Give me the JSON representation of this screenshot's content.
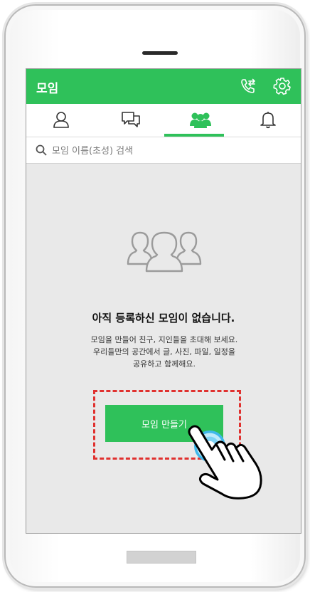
{
  "app": {
    "title": "모임"
  },
  "tabs": [
    {
      "name": "friends",
      "icon": "person-icon",
      "active": false
    },
    {
      "name": "chats",
      "icon": "chat-bubbles-icon",
      "active": false
    },
    {
      "name": "groups",
      "icon": "group-icon",
      "active": true
    },
    {
      "name": "notifications",
      "icon": "bell-icon",
      "active": false
    }
  ],
  "search": {
    "placeholder": "모임 이름(초성) 검색"
  },
  "empty": {
    "title": "아직 등록하신 모임이 없습니다.",
    "desc_line1": "모임을 만들어 친구, 지인들을 초대해 보세요.",
    "desc_line2": "우리들만의 공간에서 글, 사진, 파일, 일정을",
    "desc_line3": "공유하고 함께해요."
  },
  "create_button": {
    "label": "모임 만들기"
  },
  "colors": {
    "accent": "#2fc15a",
    "highlight_border": "#e0312f",
    "screen_background": "#e9e9e9"
  },
  "icons": {
    "call_forward": "phone-forward-icon",
    "settings": "gear-icon",
    "search": "search-icon",
    "empty_state": "group-outline-icon",
    "pointer": "pointing-hand-icon"
  }
}
